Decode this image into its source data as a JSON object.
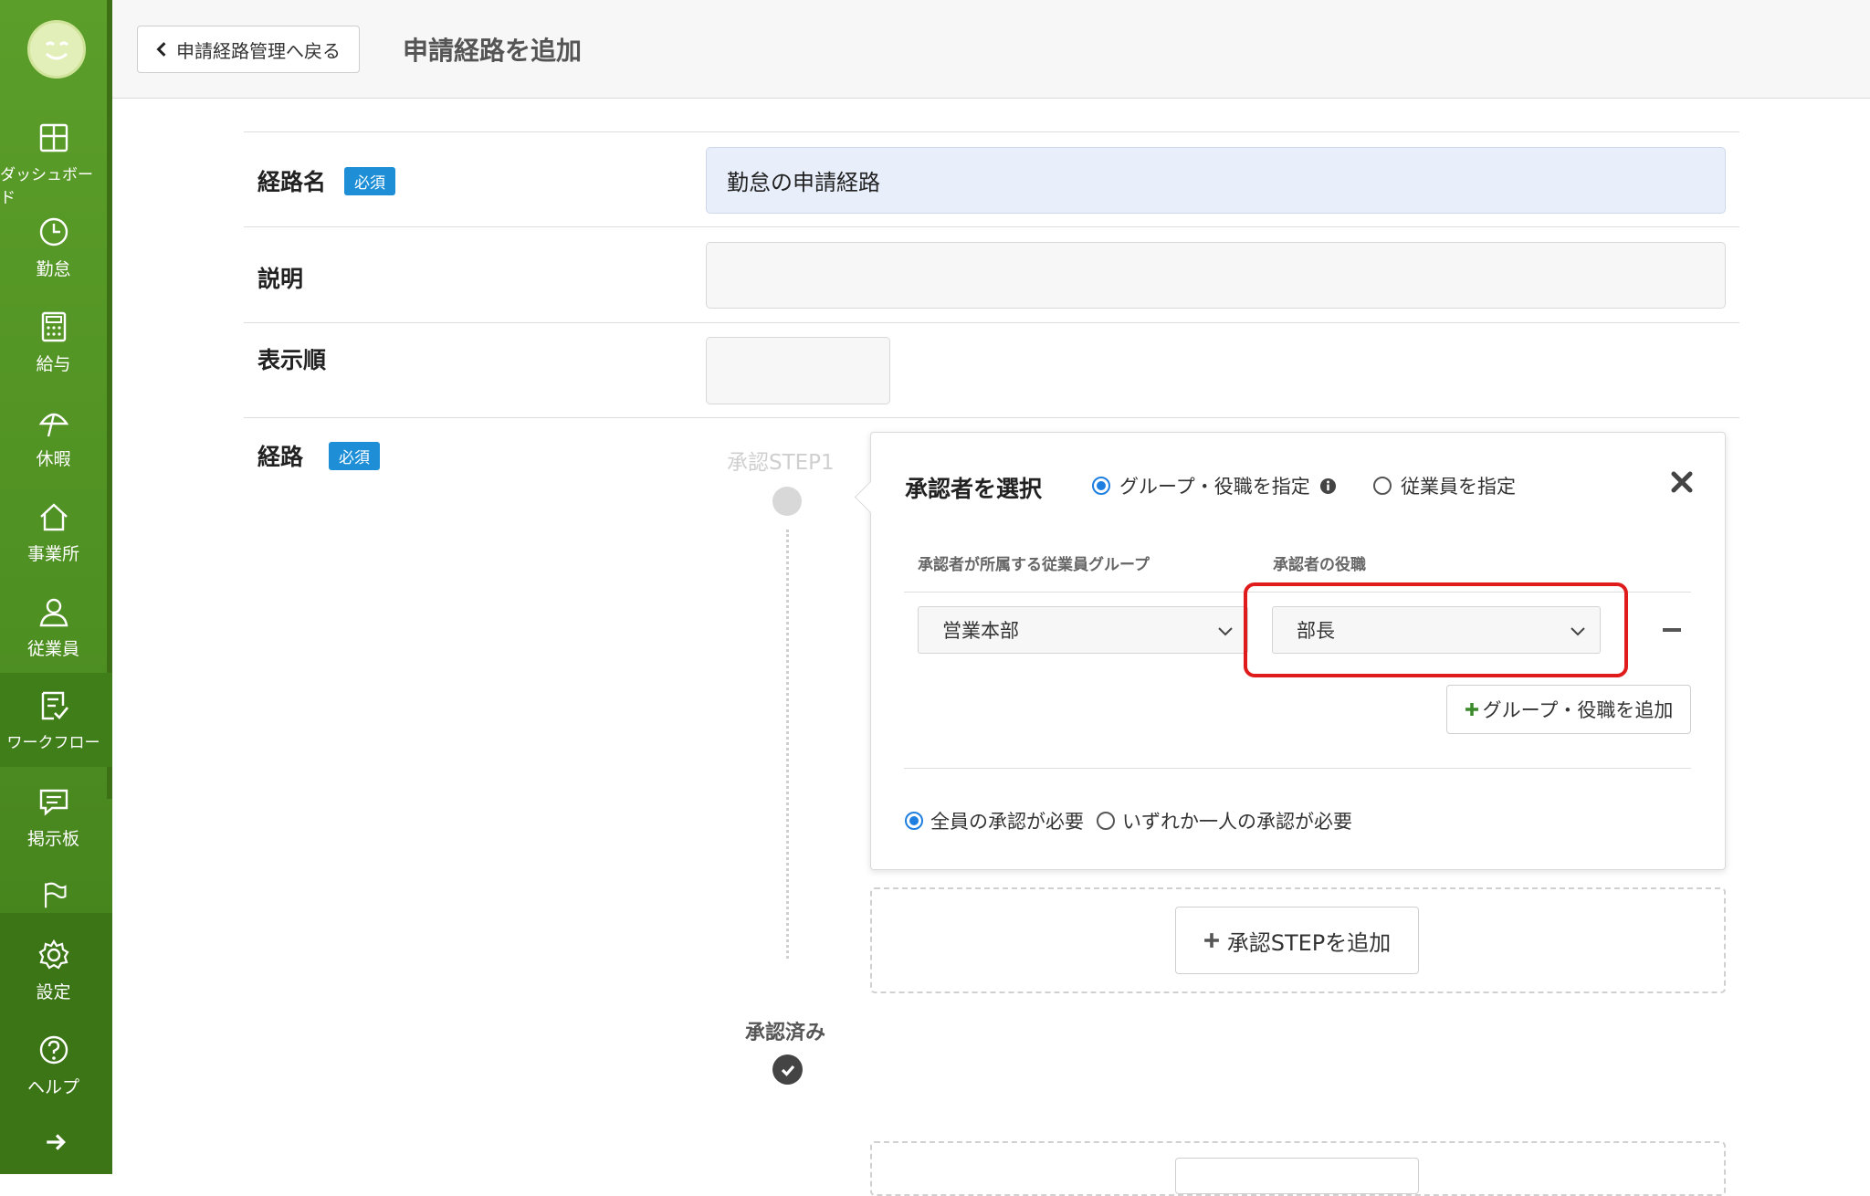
{
  "sidebar": {
    "items": [
      {
        "label": "ダッシュボード",
        "icon": "dashboard-icon"
      },
      {
        "label": "勤怠",
        "icon": "clock-icon"
      },
      {
        "label": "給与",
        "icon": "calculator-icon"
      },
      {
        "label": "休暇",
        "icon": "umbrella-icon"
      },
      {
        "label": "事業所",
        "icon": "home-icon"
      },
      {
        "label": "従業員",
        "icon": "user-icon"
      },
      {
        "label": "ワークフロー",
        "icon": "workflow-icon"
      },
      {
        "label": "掲示板",
        "icon": "message-icon"
      },
      {
        "label": "",
        "icon": "flag-icon"
      },
      {
        "label": "設定",
        "icon": "gear-icon"
      },
      {
        "label": "ヘルプ",
        "icon": "help-icon"
      }
    ],
    "active_item": "ワークフロー",
    "colors": {
      "accent": "#4e8f22",
      "active": "#3f7e19"
    }
  },
  "header": {
    "back_label": "申請経路管理へ戻る",
    "title": "申請経路を追加"
  },
  "form": {
    "required_badge": "必須",
    "route_name": {
      "label": "経路名",
      "value": "勤怠の申請経路"
    },
    "description": {
      "label": "説明",
      "value": ""
    },
    "display_order": {
      "label": "表示順",
      "value": ""
    },
    "route": {
      "label": "経路"
    }
  },
  "steps": {
    "step1_label": "承認STEP1",
    "approved_label": "承認済み"
  },
  "approver_panel": {
    "title": "承認者を選択",
    "mode_options": [
      {
        "label": "グループ・役職を指定",
        "selected": true
      },
      {
        "label": "従業員を指定",
        "selected": false
      }
    ],
    "group_column": "承認者が所属する従業員グループ",
    "role_column": "承認者の役職",
    "group_value": "営業本部",
    "role_value": "部長",
    "add_group_label": "グループ・役職を追加",
    "approval_options": [
      {
        "label": "全員の承認が必要",
        "selected": true
      },
      {
        "label": "いずれか一人の承認が必要",
        "selected": false
      }
    ]
  },
  "add_step_label": "承認STEPを追加",
  "colors": {
    "badge": "#1e8fd6",
    "radio": "#1e7fe0",
    "highlight": "#e01b1b",
    "plus": "#3a8a2a"
  }
}
